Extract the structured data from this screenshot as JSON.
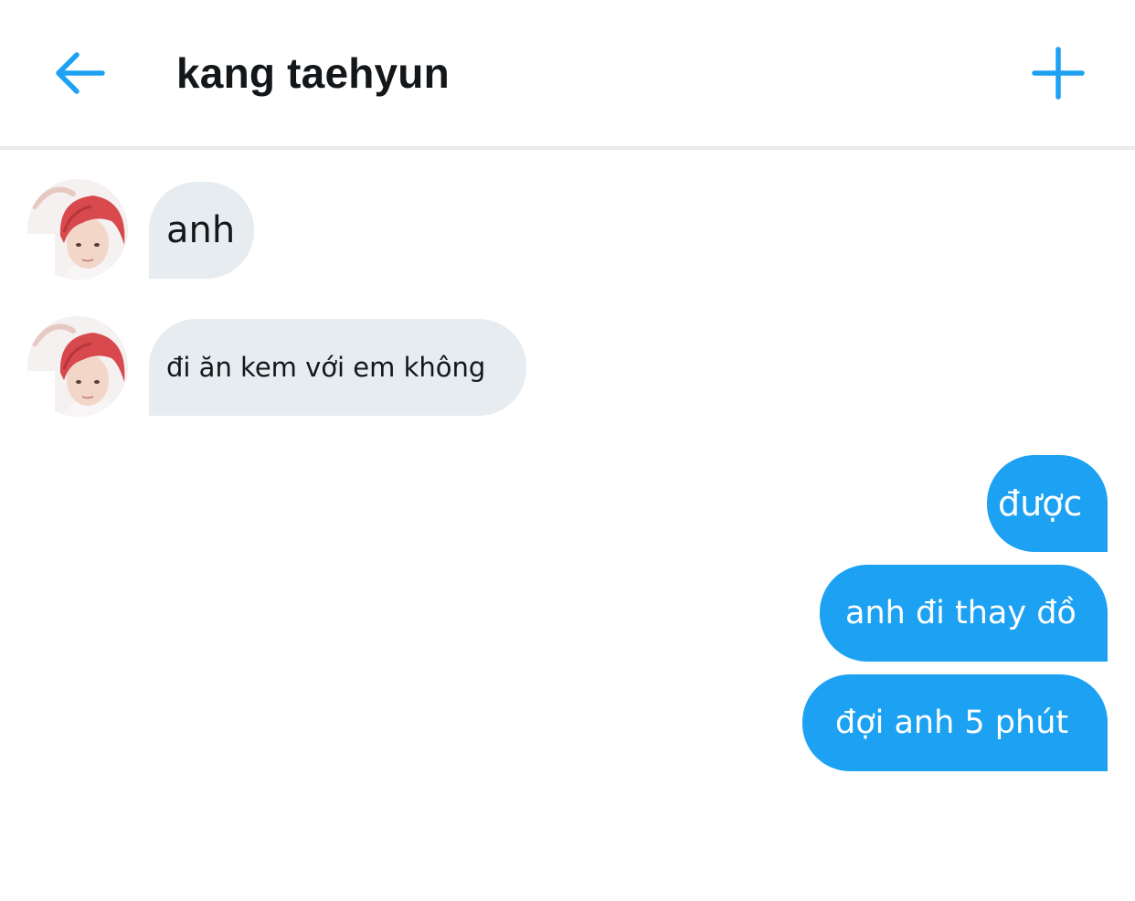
{
  "header": {
    "title": "kang taehyun",
    "back_icon": "arrow-left-icon",
    "add_icon": "plus-icon",
    "accent_color": "#1da1f2"
  },
  "contact": {
    "avatar": "profile-photo-avatar"
  },
  "messages": [
    {
      "direction": "incoming",
      "text": "anh"
    },
    {
      "direction": "incoming",
      "text": "đi ăn kem với em không"
    },
    {
      "direction": "outgoing",
      "text": "được"
    },
    {
      "direction": "outgoing",
      "text": "anh đi thay đồ"
    },
    {
      "direction": "outgoing",
      "text": "đợi anh 5 phút"
    }
  ],
  "colors": {
    "incoming_bubble": "#e6ecf0",
    "outgoing_bubble": "#1da1f2",
    "divider": "#e8eaec",
    "title_text": "#14171a"
  }
}
